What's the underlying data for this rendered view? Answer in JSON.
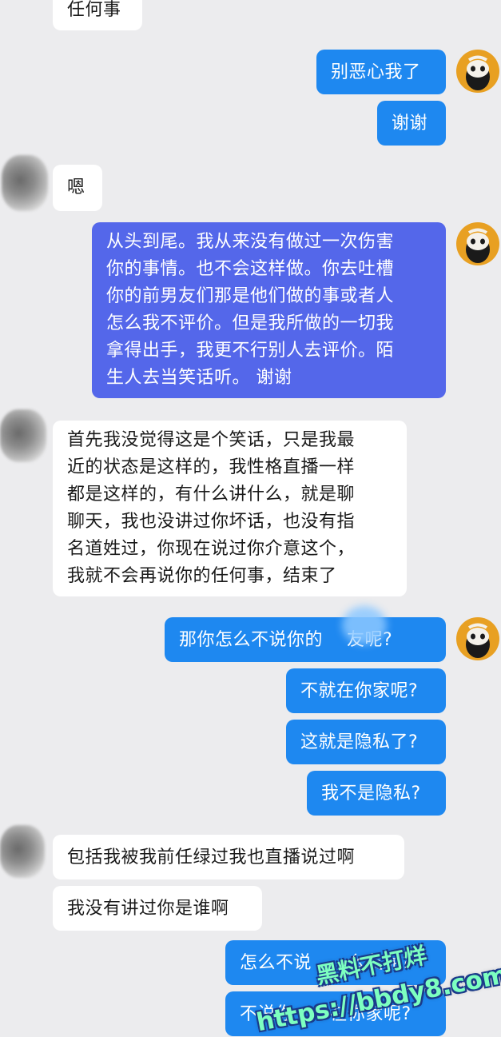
{
  "messages": [
    {
      "side": "in",
      "text": "任何事"
    },
    {
      "side": "out",
      "text": "别恶心我了"
    },
    {
      "side": "out",
      "text": "谢谢"
    },
    {
      "side": "in",
      "text": "嗯"
    },
    {
      "side": "out",
      "text": "从头到尾。我从来没有做过一次伤害\n你的事情。也不会这样做。你去吐槽\n你的前男友们那是他们做的事或者人\n怎么我不评价。但是我所做的一切我\n拿得出手，我更不行别人去评价。陌\n生人去当笑话听。 谢谢"
    },
    {
      "side": "in",
      "text": "首先我没觉得这是个笑话，只是我最\n近的状态是这样的，我性格直播一样\n都是这样的，有什么讲什么，就是聊\n聊天，我也没讲过你坏话，也没有指\n名道姓过，你现在说过你介意这个，\n我就不会再说你的任何事，结束了"
    },
    {
      "side": "out",
      "text": "那你怎么不说你的    友呢?"
    },
    {
      "side": "out",
      "text": "不就在你家呢?"
    },
    {
      "side": "out",
      "text": "这就是隐私了?"
    },
    {
      "side": "out",
      "text": "我不是隐私?"
    },
    {
      "side": "in",
      "text": "包括我被我前任绿过我也直播说过啊"
    },
    {
      "side": "in",
      "text": "我没有讲过你是谁啊"
    },
    {
      "side": "out",
      "text": "怎么不说      么友呢?"
    },
    {
      "side": "out",
      "text": "不说你      在你家呢?"
    }
  ],
  "watermark": {
    "line1": "黑料不打烊",
    "line2": "https://bbdy8.com"
  },
  "colors": {
    "background": "#ececee",
    "incoming_bubble": "#ffffff",
    "outgoing_bubble": "#1e88f0",
    "outgoing_bubble_long": "#5467ea",
    "self_avatar": "#e8a022",
    "watermark": "#7dffc0"
  }
}
